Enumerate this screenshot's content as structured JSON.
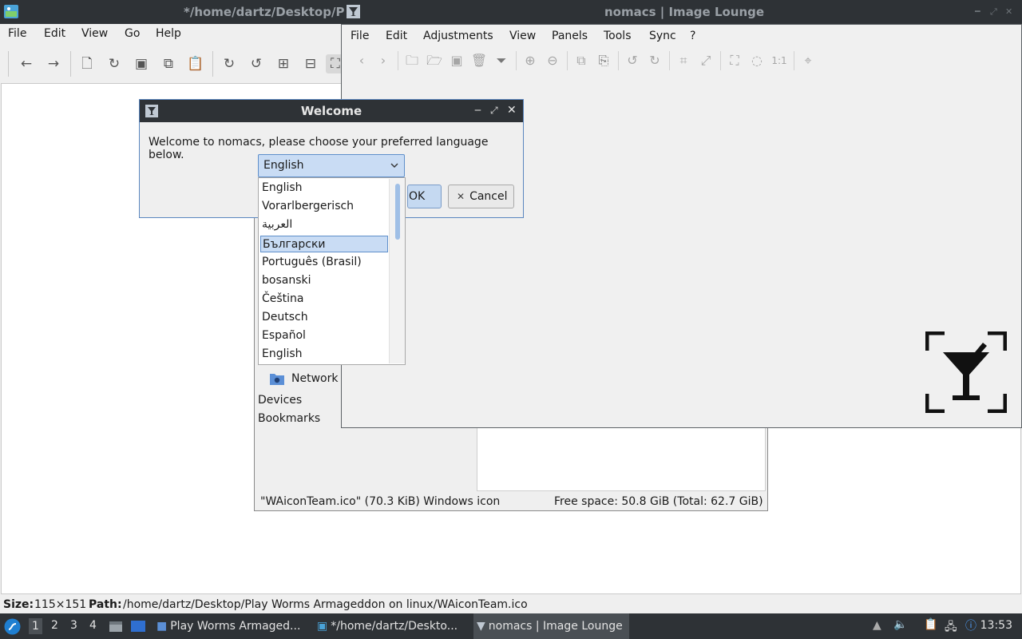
{
  "bg_window": {
    "title": "*/home/dartz/Desktop/P",
    "menu": [
      "File",
      "Edit",
      "View",
      "Go",
      "Help"
    ],
    "status": {
      "size_label": "Size:",
      "size_value": "115×151",
      "path_label": "Path:",
      "path_value": "/home/dartz/Desktop/Play Worms Armageddon on linux/WAiconTeam.ico"
    }
  },
  "file_manager": {
    "side_items": {
      "network": "Network",
      "devices": "Devices",
      "bookmarks": "Bookmarks"
    },
    "status_left": "\"WAiconTeam.ico\" (70.3 KiB) Windows icon",
    "status_right": "Free space: 50.8 GiB (Total: 62.7 GiB)"
  },
  "nomacs": {
    "title": "nomacs | Image Lounge",
    "menu": [
      "File",
      "Edit",
      "Adjustments",
      "View",
      "Panels",
      "Tools",
      "Sync",
      "?"
    ]
  },
  "dialog": {
    "title": "Welcome",
    "message": "Welcome to nomacs, please choose your preferred language below.",
    "selected_language": "English",
    "ok_label": "OK",
    "cancel_label": "Cancel",
    "languages": [
      "English",
      "Vorarlbergerisch",
      "العربية",
      "Български",
      "Português (Brasil)",
      "bosanski",
      "Čeština",
      "Deutsch",
      "Español",
      "English"
    ],
    "highlighted_index": 3
  },
  "taskbar": {
    "workspaces": [
      "1",
      "2",
      "3",
      "4"
    ],
    "tasks": [
      "Play Worms Armaged...",
      "*/home/dartz/Deskto...",
      "nomacs | Image Lounge"
    ],
    "clock": "13:53"
  },
  "colors": {
    "titlebar": "#2e3236",
    "selection": "#c9dcf4",
    "selection_border": "#5f8fca"
  }
}
